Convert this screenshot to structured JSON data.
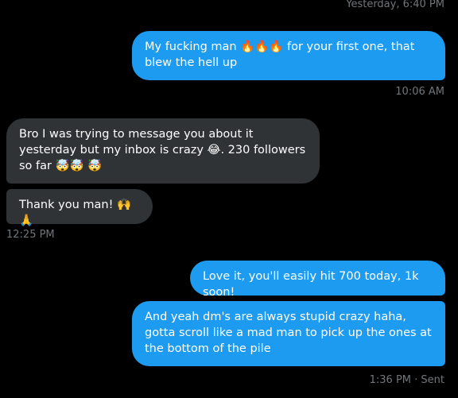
{
  "conversation": {
    "timestamps": {
      "top": "Yesterday, 6:40 PM",
      "after_first": "10:06 AM",
      "after_incoming": "12:25 PM",
      "final": "1:36 PM · Sent"
    },
    "messages": [
      {
        "id": "m1",
        "direction": "outgoing",
        "text": "My fucking man 🔥🔥🔥 for your first one, that blew the hell up"
      },
      {
        "id": "m2",
        "direction": "incoming",
        "text": "Bro I was trying to message you about it yesterday but my inbox is crazy 😂. 230 followers so far 🤯🤯 🤯"
      },
      {
        "id": "m3",
        "direction": "incoming",
        "text": "Thank you man! 🙌🙏"
      },
      {
        "id": "m4",
        "direction": "outgoing",
        "text": "Love it, you'll easily hit 700 today, 1k soon!"
      },
      {
        "id": "m5",
        "direction": "outgoing",
        "text": "And yeah dm's are always stupid crazy haha, gotta scroll like a mad man to pick up the ones at the bottom of the pile"
      }
    ]
  },
  "colors": {
    "background": "#000000",
    "outgoing_bubble": "#1d9bf0",
    "incoming_bubble": "#2f3336",
    "timestamp": "#71767b"
  }
}
